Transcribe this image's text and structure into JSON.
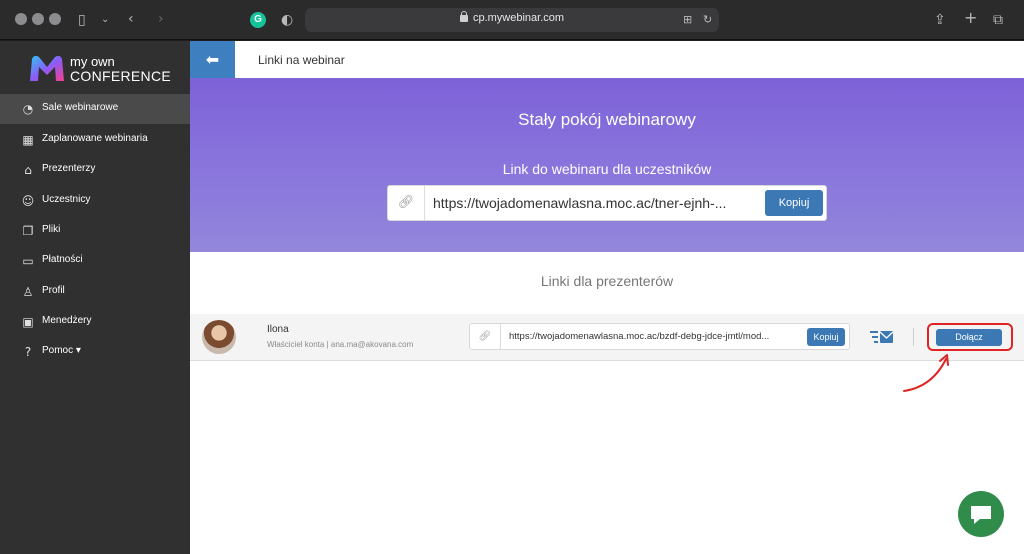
{
  "browser": {
    "url": "cp.mywebinar.com",
    "grammarly_letter": "G"
  },
  "sidebar": {
    "logo_line1": "my own",
    "logo_line2": "CONFERENCE",
    "items": [
      {
        "label": "Sale webinarowe",
        "icon": "webinar-room-icon",
        "glyph": "◔",
        "active": true
      },
      {
        "label": "Zaplanowane webinaria",
        "icon": "calendar-icon",
        "glyph": "▦",
        "active": false
      },
      {
        "label": "Prezenterzy",
        "icon": "presenter-icon",
        "glyph": "⌂",
        "active": false
      },
      {
        "label": "Uczestnicy",
        "icon": "users-icon",
        "glyph": "☺",
        "active": false
      },
      {
        "label": "Pliki",
        "icon": "files-icon",
        "glyph": "❐",
        "active": false
      },
      {
        "label": "Płatności",
        "icon": "card-icon",
        "glyph": "▭",
        "active": false
      },
      {
        "label": "Profil",
        "icon": "profile-icon",
        "glyph": "♙",
        "active": false
      },
      {
        "label": "Menedżery",
        "icon": "managers-icon",
        "glyph": "▣",
        "active": false
      },
      {
        "label": "Pomoc ▾",
        "icon": "help-icon",
        "glyph": "?",
        "active": false
      }
    ]
  },
  "header": {
    "title": "Linki na webinar"
  },
  "hero": {
    "title": "Stały pokój webinarowy",
    "subtitle": "Link do webinaru dla uczestników",
    "link": "https://twojadomenawlasna.moc.ac/tner-ejnh-...",
    "copy_label": "Kopiuj"
  },
  "presenters": {
    "title": "Linki dla prezenterów",
    "rows": [
      {
        "name": "Ilona",
        "role": "Właściciel konta | ana.ma@akovana.com",
        "link": "https://twojadomenawlasna.moc.ac/bzdf-debg-jdce-jmtl/mod...",
        "copy_label": "Kopiuj",
        "join_label": "Dołącz"
      }
    ]
  },
  "colors": {
    "accent": "#3b78b4",
    "sidebar": "#303030",
    "hero": "#8a76dc",
    "highlight": "#e02424",
    "chat": "#2f8c4a"
  }
}
